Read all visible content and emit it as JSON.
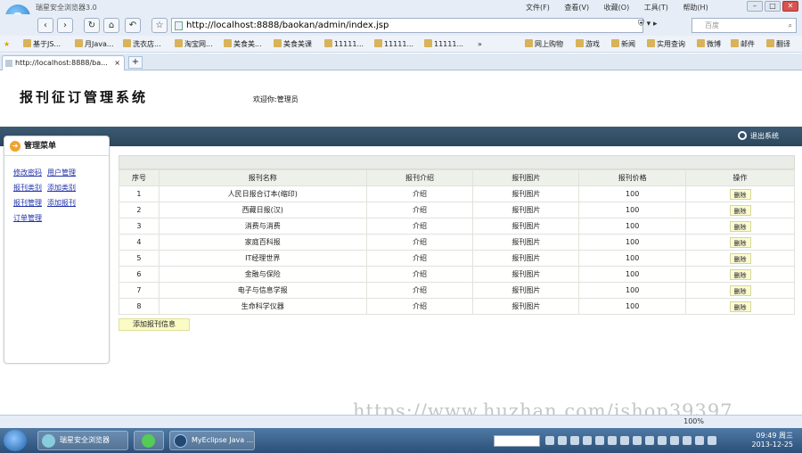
{
  "browser": {
    "app_title": "瑞星安全浏览器3.0",
    "menus": [
      "文件(F)",
      "查看(V)",
      "收藏(O)",
      "工具(T)",
      "帮助(H)"
    ],
    "address": "http://localhost:8888/baokan/admin/index.jsp",
    "search_placeholder": "百度",
    "bookmarks": [
      "基于JS...",
      "月Java...",
      "洗衣店...",
      "淘宝网...",
      "美食美...",
      "美食美课",
      "11111...",
      "11111...",
      "11111...",
      "网上购物",
      "游戏",
      "新闻",
      "实用查询",
      "微博",
      "邮件",
      "翻译"
    ],
    "tab_label": "http://localhost:8888/ba...",
    "zoom": "100%"
  },
  "header": {
    "title": "报刊征订管理系统",
    "welcome": "欢迎你:管理员",
    "logout": "退出系统"
  },
  "sidebar": {
    "title": "管理菜单",
    "rows": [
      [
        "修改密码",
        "用户管理"
      ],
      [
        "报刊类别",
        "添加类别"
      ],
      [
        "报刊管理",
        "添加报刊"
      ],
      [
        "订单管理"
      ]
    ]
  },
  "table": {
    "headers": [
      "序号",
      "报刊名称",
      "报刊介绍",
      "报刊图片",
      "报刊价格",
      "操作"
    ],
    "rows": [
      {
        "no": "1",
        "name": "人民日报合订本(缩印)",
        "intro": "介绍",
        "image": "报刊图片",
        "price": "100",
        "action": "删除"
      },
      {
        "no": "2",
        "name": "西藏日报(汉)",
        "intro": "介绍",
        "image": "报刊图片",
        "price": "100",
        "action": "删除"
      },
      {
        "no": "3",
        "name": "消费与消费",
        "intro": "介绍",
        "image": "报刊图片",
        "price": "100",
        "action": "删除"
      },
      {
        "no": "4",
        "name": "家庭百科报",
        "intro": "介绍",
        "image": "报刊图片",
        "price": "100",
        "action": "删除"
      },
      {
        "no": "5",
        "name": "IT经理世界",
        "intro": "介绍",
        "image": "报刊图片",
        "price": "100",
        "action": "删除"
      },
      {
        "no": "6",
        "name": "金融与保险",
        "intro": "介绍",
        "image": "报刊图片",
        "price": "100",
        "action": "删除"
      },
      {
        "no": "7",
        "name": "电子与信息学报",
        "intro": "介绍",
        "image": "报刊图片",
        "price": "100",
        "action": "删除"
      },
      {
        "no": "8",
        "name": "生命科学仪器",
        "intro": "介绍",
        "image": "报刊图片",
        "price": "100",
        "action": "删除"
      }
    ],
    "add_button": "添加报刊信息"
  },
  "watermark": "https://www.huzhan.com/ishop39397",
  "taskbar": {
    "tasks": [
      "瑞星安全浏览器",
      "",
      "MyEclipse Java ..."
    ],
    "time": "09:49 周三",
    "date": "2013-12-25"
  }
}
